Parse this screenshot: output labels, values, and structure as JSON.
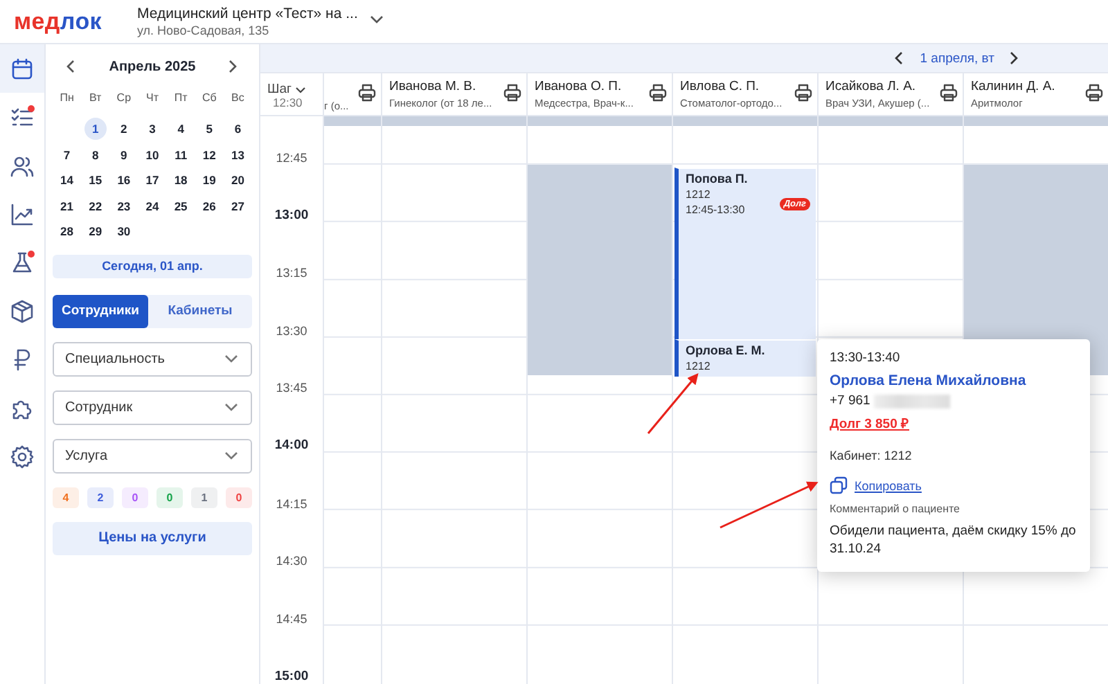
{
  "header": {
    "logo": [
      {
        "text": "мед",
        "color": "#e8332a"
      },
      {
        "text": "лок",
        "color": "#2a55c7"
      }
    ],
    "clinic_name": "Медицинский центр «Тест» на ...",
    "address": "ул. Ново-Садовая, 135"
  },
  "rail": [
    {
      "kind": "calendar",
      "selected": true,
      "badge": false
    },
    {
      "kind": "checklist",
      "selected": false,
      "badge": true
    },
    {
      "kind": "people",
      "selected": false,
      "badge": false
    },
    {
      "kind": "chart",
      "selected": false,
      "badge": false
    },
    {
      "kind": "flask",
      "selected": false,
      "badge": true
    },
    {
      "kind": "box",
      "selected": false,
      "badge": false
    },
    {
      "kind": "ruble",
      "selected": false,
      "badge": false
    },
    {
      "kind": "puzzle",
      "selected": false,
      "badge": false
    },
    {
      "kind": "gear",
      "selected": false,
      "badge": false
    }
  ],
  "calendar": {
    "month": "Апрель 2025",
    "weekdays": [
      "Пн",
      "Вт",
      "Ср",
      "Чт",
      "Пт",
      "Сб",
      "Вс"
    ],
    "weeks": [
      {
        "kind": "first",
        "days": [
          {
            "label": "1",
            "selected": true
          },
          {
            "label": "2",
            "selected": false
          },
          {
            "label": "3",
            "selected": false
          },
          {
            "label": "4",
            "selected": false
          },
          {
            "label": "5",
            "selected": false
          },
          {
            "label": "6",
            "selected": false
          }
        ]
      },
      {
        "kind": "full",
        "days": [
          {
            "label": "7",
            "selected": false
          },
          {
            "label": "8",
            "selected": false
          },
          {
            "label": "9",
            "selected": false
          },
          {
            "label": "10",
            "selected": false
          },
          {
            "label": "11",
            "selected": false
          },
          {
            "label": "12",
            "selected": false
          },
          {
            "label": "13",
            "selected": false
          }
        ]
      },
      {
        "kind": "full",
        "days": [
          {
            "label": "14",
            "selected": false
          },
          {
            "label": "15",
            "selected": false
          },
          {
            "label": "16",
            "selected": false
          },
          {
            "label": "17",
            "selected": false
          },
          {
            "label": "18",
            "selected": false
          },
          {
            "label": "19",
            "selected": false
          },
          {
            "label": "20",
            "selected": false
          }
        ]
      },
      {
        "kind": "full",
        "days": [
          {
            "label": "21",
            "selected": false
          },
          {
            "label": "22",
            "selected": false
          },
          {
            "label": "23",
            "selected": false
          },
          {
            "label": "24",
            "selected": false
          },
          {
            "label": "25",
            "selected": false
          },
          {
            "label": "26",
            "selected": false
          },
          {
            "label": "27",
            "selected": false
          }
        ]
      },
      {
        "kind": "last",
        "days": [
          {
            "label": "28",
            "selected": false
          },
          {
            "label": "29",
            "selected": false
          },
          {
            "label": "30",
            "selected": false
          }
        ]
      }
    ],
    "today_button": "Сегодня, 01 апр."
  },
  "tabs": [
    {
      "label": "Сотрудники",
      "selected": true
    },
    {
      "label": "Кабинеты",
      "selected": false
    }
  ],
  "filters": [
    {
      "placeholder": "Специальность"
    },
    {
      "placeholder": "Сотрудник"
    },
    {
      "placeholder": "Услуга"
    }
  ],
  "counters": [
    {
      "value": "4",
      "color": "#f0701e"
    },
    {
      "value": "2",
      "color": "#3b5bdb"
    },
    {
      "value": "0",
      "color": "#a855f7"
    },
    {
      "value": "0",
      "color": "#16a34a"
    },
    {
      "value": "1",
      "color": "#6b7280"
    },
    {
      "value": "0",
      "color": "#ef4444"
    }
  ],
  "prices_button": "Цены на услуги",
  "date_nav": {
    "label": "1 апреля, вт"
  },
  "schedule": {
    "step_label": "Шаг",
    "first_time": "12:30",
    "times": [
      {
        "label": "12:45",
        "major": false
      },
      {
        "label": "13:00",
        "major": true
      },
      {
        "label": "13:15",
        "major": false
      },
      {
        "label": "13:30",
        "major": false
      },
      {
        "label": "13:45",
        "major": false
      },
      {
        "label": "14:00",
        "major": true
      },
      {
        "label": "14:15",
        "major": false
      },
      {
        "label": "14:30",
        "major": false
      },
      {
        "label": "14:45",
        "major": false
      },
      {
        "label": "15:00",
        "major": true
      }
    ],
    "columns": [
      {
        "kind": "partial",
        "specialty": "г (о...",
        "slots": [
          {
            "kind": "strip"
          }
        ]
      },
      {
        "kind": "full",
        "name": "Иванова М. В.",
        "specialty": "Гинеколог (от 18 ле...",
        "slots": [
          {
            "kind": "strip"
          }
        ]
      },
      {
        "kind": "full",
        "name": "Иванова О. П.",
        "specialty": "Медсестра, Врач-к...",
        "slots": [
          {
            "kind": "strip"
          },
          {
            "kind": "blocked"
          }
        ]
      },
      {
        "kind": "full",
        "name": "Ивлова С. П.",
        "specialty": "Стоматолог-ортодо...",
        "slots": [
          {
            "kind": "strip"
          },
          {
            "kind": "appointment",
            "patient": "Попова П.",
            "room": "1212",
            "time": "12:45-13:30",
            "badge": "Долг"
          },
          {
            "kind": "appointment",
            "patient": "Орлова Е. М.",
            "room": "1212"
          }
        ]
      },
      {
        "kind": "full",
        "name": "Исайкова Л. А.",
        "specialty": "Врач УЗИ, Акушер (...",
        "slots": [
          {
            "kind": "strip"
          }
        ]
      },
      {
        "kind": "full",
        "name": "Калинин Д. А.",
        "specialty": "Аритмолог",
        "slots": [
          {
            "kind": "strip"
          },
          {
            "kind": "blocked"
          }
        ]
      }
    ]
  },
  "popup": {
    "time": "13:30-13:40",
    "patient": "Орлова Елена Михайловна",
    "phone": "+7 961",
    "debt": "Долг 3 850 ₽",
    "room": "Кабинет: 1212",
    "copy_link": "Копировать",
    "comment_label": "Комментарий о пациенте",
    "comment": "Обидели пациента, даём скидку 15% до 31.10.24"
  }
}
